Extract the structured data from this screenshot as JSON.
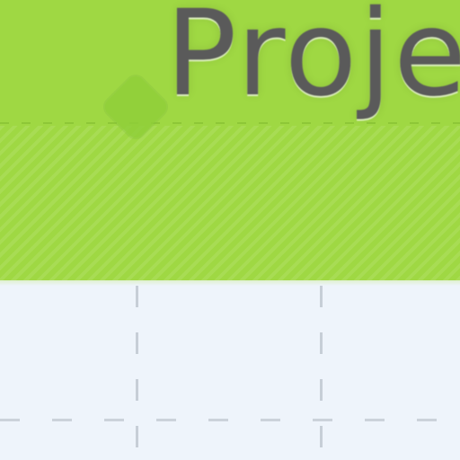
{
  "header": {
    "title_text": "Proje",
    "accent_color": "#9fd843",
    "title_color": "#5a5a5a",
    "marker_icon": "diamond-marker-icon"
  },
  "grid": {
    "background_color": "#eef4fb",
    "line_color": "#96a0aa"
  }
}
